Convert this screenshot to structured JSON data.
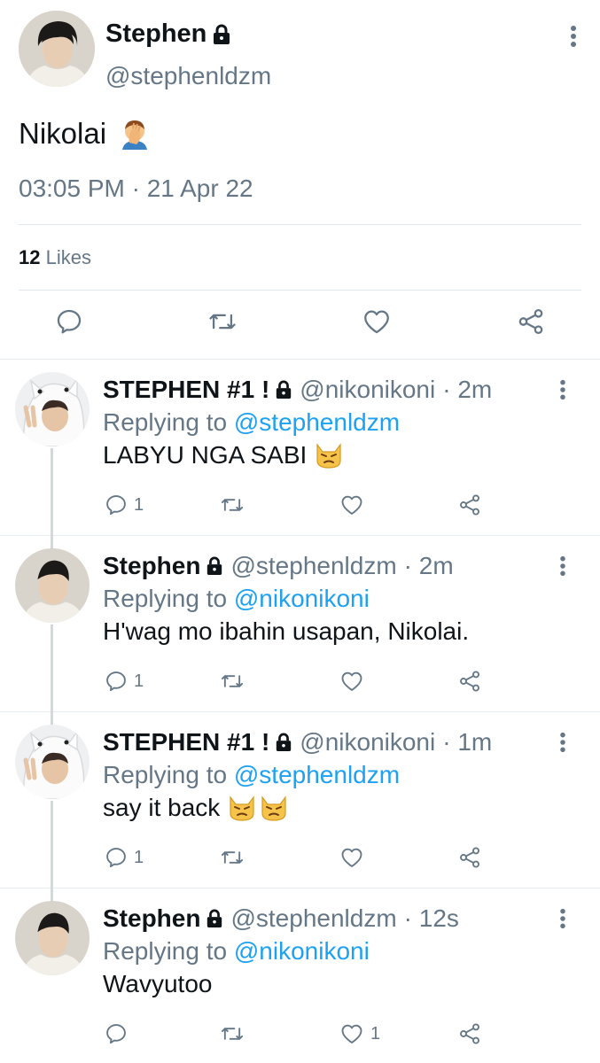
{
  "main_tweet": {
    "name": "Stephen",
    "handle": "@stephenldzm",
    "text": "Nikolai",
    "emoji": "facepalm",
    "timestamp": "03:05 PM · 21 Apr 22",
    "likes_count": "12",
    "likes_label": "Likes",
    "actions": [
      "reply-icon",
      "retweet-icon",
      "like-icon",
      "share-icon"
    ]
  },
  "replies": [
    {
      "name": "STEPHEN #1 !",
      "handle": "@nikonikoni",
      "time": "· 2m",
      "replying_prefix": "Replying to",
      "replying_to": "@stephenldzm",
      "text": "LABYU NGA SABI",
      "emojis": 1,
      "reply_count": "1",
      "like_count": ""
    },
    {
      "name": "Stephen",
      "handle": "@stephenldzm",
      "time": "· 2m",
      "replying_prefix": "Replying to",
      "replying_to": "@nikonikoni",
      "text": "H'wag mo ibahin usapan, Nikolai.",
      "emojis": 0,
      "reply_count": "1",
      "like_count": ""
    },
    {
      "name": "STEPHEN #1 !",
      "handle": "@nikonikoni",
      "time": "· 1m",
      "replying_prefix": "Replying to",
      "replying_to": "@stephenldzm",
      "text": "say it back",
      "emojis": 2,
      "reply_count": "1",
      "like_count": ""
    },
    {
      "name": "Stephen",
      "handle": "@stephenldzm",
      "time": "· 12s",
      "replying_prefix": "Replying to",
      "replying_to": "@nikonikoni",
      "text": "Wavyutoo",
      "emojis": 0,
      "reply_count": "",
      "like_count": "1"
    }
  ],
  "colors": {
    "text": "#0f1419",
    "secondary": "#657786",
    "link": "#1da1f2",
    "divider": "#e6ecf0"
  }
}
